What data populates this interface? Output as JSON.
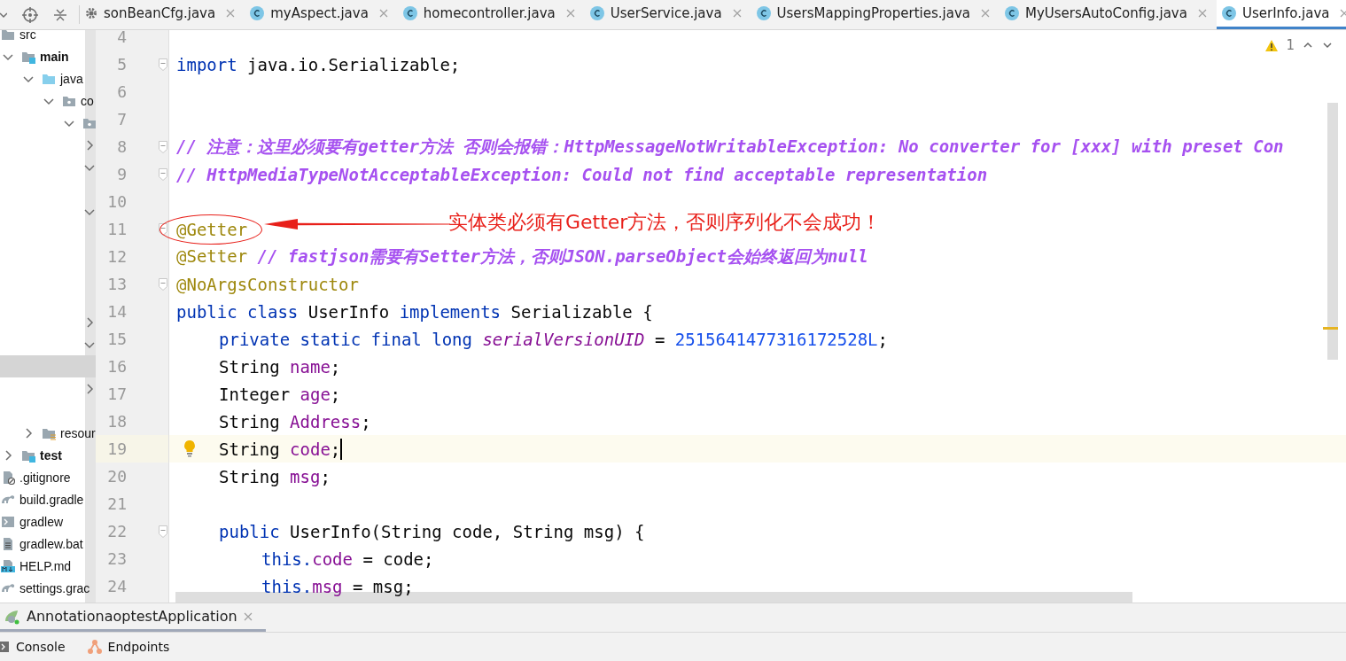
{
  "project_tree": [
    {
      "label": "src",
      "kind": "folder",
      "expanded": true,
      "selected": false,
      "children": [
        {
          "label": "main",
          "kind": "source",
          "expanded": true,
          "selected": false,
          "children": [
            {
              "label": "java",
              "kind": "java",
              "expanded": true,
              "selected": false,
              "children": [
                {
                  "label": "co",
                  "kind": "package",
                  "expanded": true,
                  "selected": false,
                  "children": [
                    {
                      "kind": "package",
                      "expanded": true,
                      "selected": false,
                      "children": [
                        {
                          "expanded": false,
                          "selected": false
                        },
                        {
                          "expanded": true,
                          "selected": false,
                          "children": [
                            {
                              "selected": false
                            }
                          ]
                        },
                        {
                          "expanded": true,
                          "selected": false,
                          "children": [
                            {
                              "selected": false
                            },
                            {
                              "selected": false
                            },
                            {
                              "selected": false
                            },
                            {
                              "selected": false
                            }
                          ]
                        },
                        {
                          "expanded": false,
                          "selected": false
                        },
                        {
                          "expanded": true,
                          "selected": false,
                          "children": [
                            {
                              "selected": true
                            }
                          ]
                        },
                        {
                          "expanded": false,
                          "selected": false
                        },
                        {
                          "selected": false
                        }
                      ]
                    }
                  ]
                }
              ]
            },
            {
              "label": "resour",
              "kind": "resources",
              "expanded": false,
              "selected": false
            }
          ]
        },
        {
          "label": "test",
          "kind": "source",
          "expanded": false,
          "selected": false
        }
      ]
    },
    {
      "label": ".gitignore",
      "kind": "ignore",
      "selected": false
    },
    {
      "label": "build.gradle",
      "kind": "gradle",
      "selected": false
    },
    {
      "label": "gradlew",
      "kind": "shell",
      "selected": false
    },
    {
      "label": "gradlew.bat",
      "kind": "text",
      "selected": false
    },
    {
      "label": "HELP.md",
      "kind": "markdown",
      "selected": false
    },
    {
      "label": "settings.grac",
      "kind": "gradle",
      "selected": false
    }
  ],
  "tabs": [
    {
      "label": "sonBeanCfg.java",
      "kind": "config",
      "selected": false
    },
    {
      "label": "myAspect.java",
      "kind": "class",
      "selected": false
    },
    {
      "label": "homecontroller.java",
      "kind": "class",
      "selected": false
    },
    {
      "label": "UserService.java",
      "kind": "class",
      "selected": false
    },
    {
      "label": "UsersMappingProperties.java",
      "kind": "class",
      "selected": false
    },
    {
      "label": "MyUsersAutoConfig.java",
      "kind": "class",
      "selected": false
    },
    {
      "label": "UserInfo.java",
      "kind": "class",
      "selected": true
    }
  ],
  "inspection": {
    "count": "1"
  },
  "lines": [
    {
      "number": "4",
      "fold": false,
      "current": false
    },
    {
      "number": "5",
      "fold": true,
      "current": false,
      "tokens": [
        {
          "text": "import",
          "kind": "kw"
        },
        {
          "text": " java.io.Serializable;",
          "kind": "plain"
        }
      ]
    },
    {
      "number": "6",
      "fold": false,
      "current": false
    },
    {
      "number": "7",
      "fold": false,
      "current": false
    },
    {
      "number": "8",
      "fold": true,
      "current": false,
      "tokens": [
        {
          "text": "// 注意：这里必须要有getter方法 否则会报错：HttpMessageNotWritableException: No converter for [xxx] with preset Con",
          "kind": "comment"
        }
      ]
    },
    {
      "number": "9",
      "fold": true,
      "current": false,
      "tokens": [
        {
          "text": "// HttpMediaTypeNotAcceptableException: Could not find acceptable representation",
          "kind": "comment"
        }
      ]
    },
    {
      "number": "10",
      "fold": false,
      "current": false
    },
    {
      "number": "11",
      "fold": true,
      "current": false,
      "tokens": [
        {
          "text": "@Getter",
          "kind": "annotation"
        }
      ]
    },
    {
      "number": "12",
      "fold": false,
      "current": false,
      "tokens": [
        {
          "text": "@Setter",
          "kind": "annotation"
        },
        {
          "text": " // fastjson需要有Setter方法，否则JSON.parseObject会始终返回为null",
          "kind": "comment"
        }
      ]
    },
    {
      "number": "13",
      "fold": true,
      "current": false,
      "tokens": [
        {
          "text": "@NoArgsConstructor",
          "kind": "annotation"
        }
      ]
    },
    {
      "number": "14",
      "fold": false,
      "current": false,
      "tokens": [
        {
          "text": "public class",
          "kind": "kw"
        },
        {
          "text": " UserInfo ",
          "kind": "plain"
        },
        {
          "text": "implements",
          "kind": "kw"
        },
        {
          "text": " Serializable {",
          "kind": "plain"
        }
      ]
    },
    {
      "number": "15",
      "fold": false,
      "current": false,
      "kind": "member",
      "tokens": [
        {
          "text": "private static final long",
          "kind": "kw"
        },
        {
          "text": " serialVersionUID",
          "kind": "static"
        },
        {
          "text": " = ",
          "kind": "plain"
        },
        {
          "text": "2515641477316172528L",
          "kind": "number"
        },
        {
          "text": ";",
          "kind": "plain"
        }
      ]
    },
    {
      "number": "16",
      "fold": false,
      "current": false,
      "kind": "member",
      "tokens": [
        {
          "text": "String ",
          "kind": "plain"
        },
        {
          "text": "name",
          "kind": "field"
        },
        {
          "text": ";",
          "kind": "plain"
        }
      ]
    },
    {
      "number": "17",
      "fold": false,
      "current": false,
      "kind": "member",
      "tokens": [
        {
          "text": "Integer ",
          "kind": "plain"
        },
        {
          "text": "age",
          "kind": "field"
        },
        {
          "text": ";",
          "kind": "plain"
        }
      ]
    },
    {
      "number": "18",
      "fold": false,
      "current": false,
      "kind": "member",
      "tokens": [
        {
          "text": "String ",
          "kind": "plain"
        },
        {
          "text": "Address",
          "kind": "field"
        },
        {
          "text": ";",
          "kind": "plain"
        }
      ]
    },
    {
      "number": "19",
      "fold": false,
      "current": true,
      "kind": "member",
      "tokens": [
        {
          "text": "String ",
          "kind": "plain"
        },
        {
          "text": "code",
          "kind": "field"
        },
        {
          "text": ";",
          "kind": "plain"
        }
      ]
    },
    {
      "number": "20",
      "fold": false,
      "current": false,
      "kind": "member",
      "tokens": [
        {
          "text": "String ",
          "kind": "plain"
        },
        {
          "text": "msg",
          "kind": "field"
        },
        {
          "text": ";",
          "kind": "plain"
        }
      ]
    },
    {
      "number": "21",
      "fold": false,
      "current": false
    },
    {
      "number": "22",
      "fold": true,
      "current": false,
      "kind": "member",
      "tokens": [
        {
          "text": "public",
          "kind": "kw"
        },
        {
          "text": " UserInfo(String code, String msg) {",
          "kind": "plain"
        }
      ]
    },
    {
      "number": "23",
      "fold": false,
      "current": false,
      "kind": "statement",
      "tokens": [
        {
          "text": "this.",
          "kind": "kw"
        },
        {
          "text": "code",
          "kind": "field"
        },
        {
          "text": " = code;",
          "kind": "plain"
        }
      ]
    },
    {
      "number": "24",
      "fold": false,
      "current": false,
      "kind": "statement",
      "tokens": [
        {
          "text": "this.",
          "kind": "kw"
        },
        {
          "text": "msg",
          "kind": "field"
        },
        {
          "text": " = msg;",
          "kind": "plain"
        }
      ]
    }
  ],
  "callout": {
    "text": "实体类必须有Getter方法，否则序列化不会成功！"
  },
  "run_tabs": [
    {
      "label": "AnnotationaoptestApplication",
      "selected": true
    }
  ],
  "tool_tabs": [
    {
      "label": "Console",
      "kind": "console"
    },
    {
      "label": "Endpoints",
      "kind": "endpoints"
    }
  ]
}
